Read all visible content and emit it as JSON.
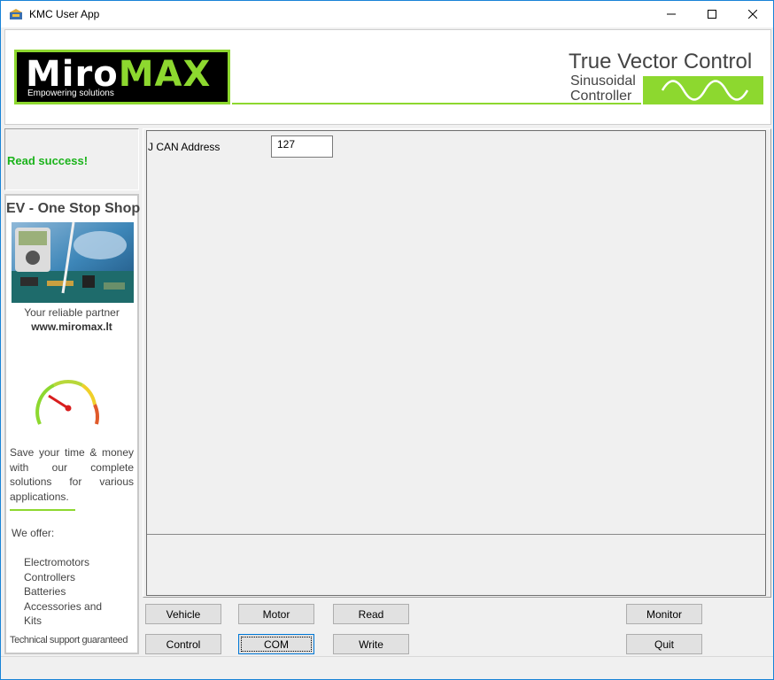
{
  "window": {
    "title": "KMC User App",
    "controls": {
      "minimize": "—",
      "maximize": "☐",
      "close": "✕"
    }
  },
  "banner": {
    "logo_main_a": "Miro",
    "logo_main_b": "MAX",
    "logo_tagline": "Empowering solutions",
    "product_title": "True Vector Control",
    "product_line1": "Sinusoidal",
    "product_line2": "Controller",
    "accent_color": "#8dd82f"
  },
  "status": {
    "text": "Read success!",
    "color": "#1bb31b"
  },
  "ad": {
    "title": "EV - One Stop Shop",
    "partner": "Your reliable partner",
    "url": "www.miromax.lt",
    "save_text": "Save your time & money with our complete solutions for various applications.",
    "offer_heading": "We offer:",
    "offer_items": [
      "Electromotors",
      "Controllers",
      "Batteries",
      "Accessories and",
      "Kits"
    ],
    "support": "Technical support guaranteed"
  },
  "params": {
    "can_address_label": "J CAN Address",
    "can_address_value": "127"
  },
  "buttons": {
    "vehicle": "Vehicle",
    "motor": "Motor",
    "read": "Read",
    "monitor": "Monitor",
    "control": "Control",
    "com": "COM",
    "write": "Write",
    "quit": "Quit"
  }
}
